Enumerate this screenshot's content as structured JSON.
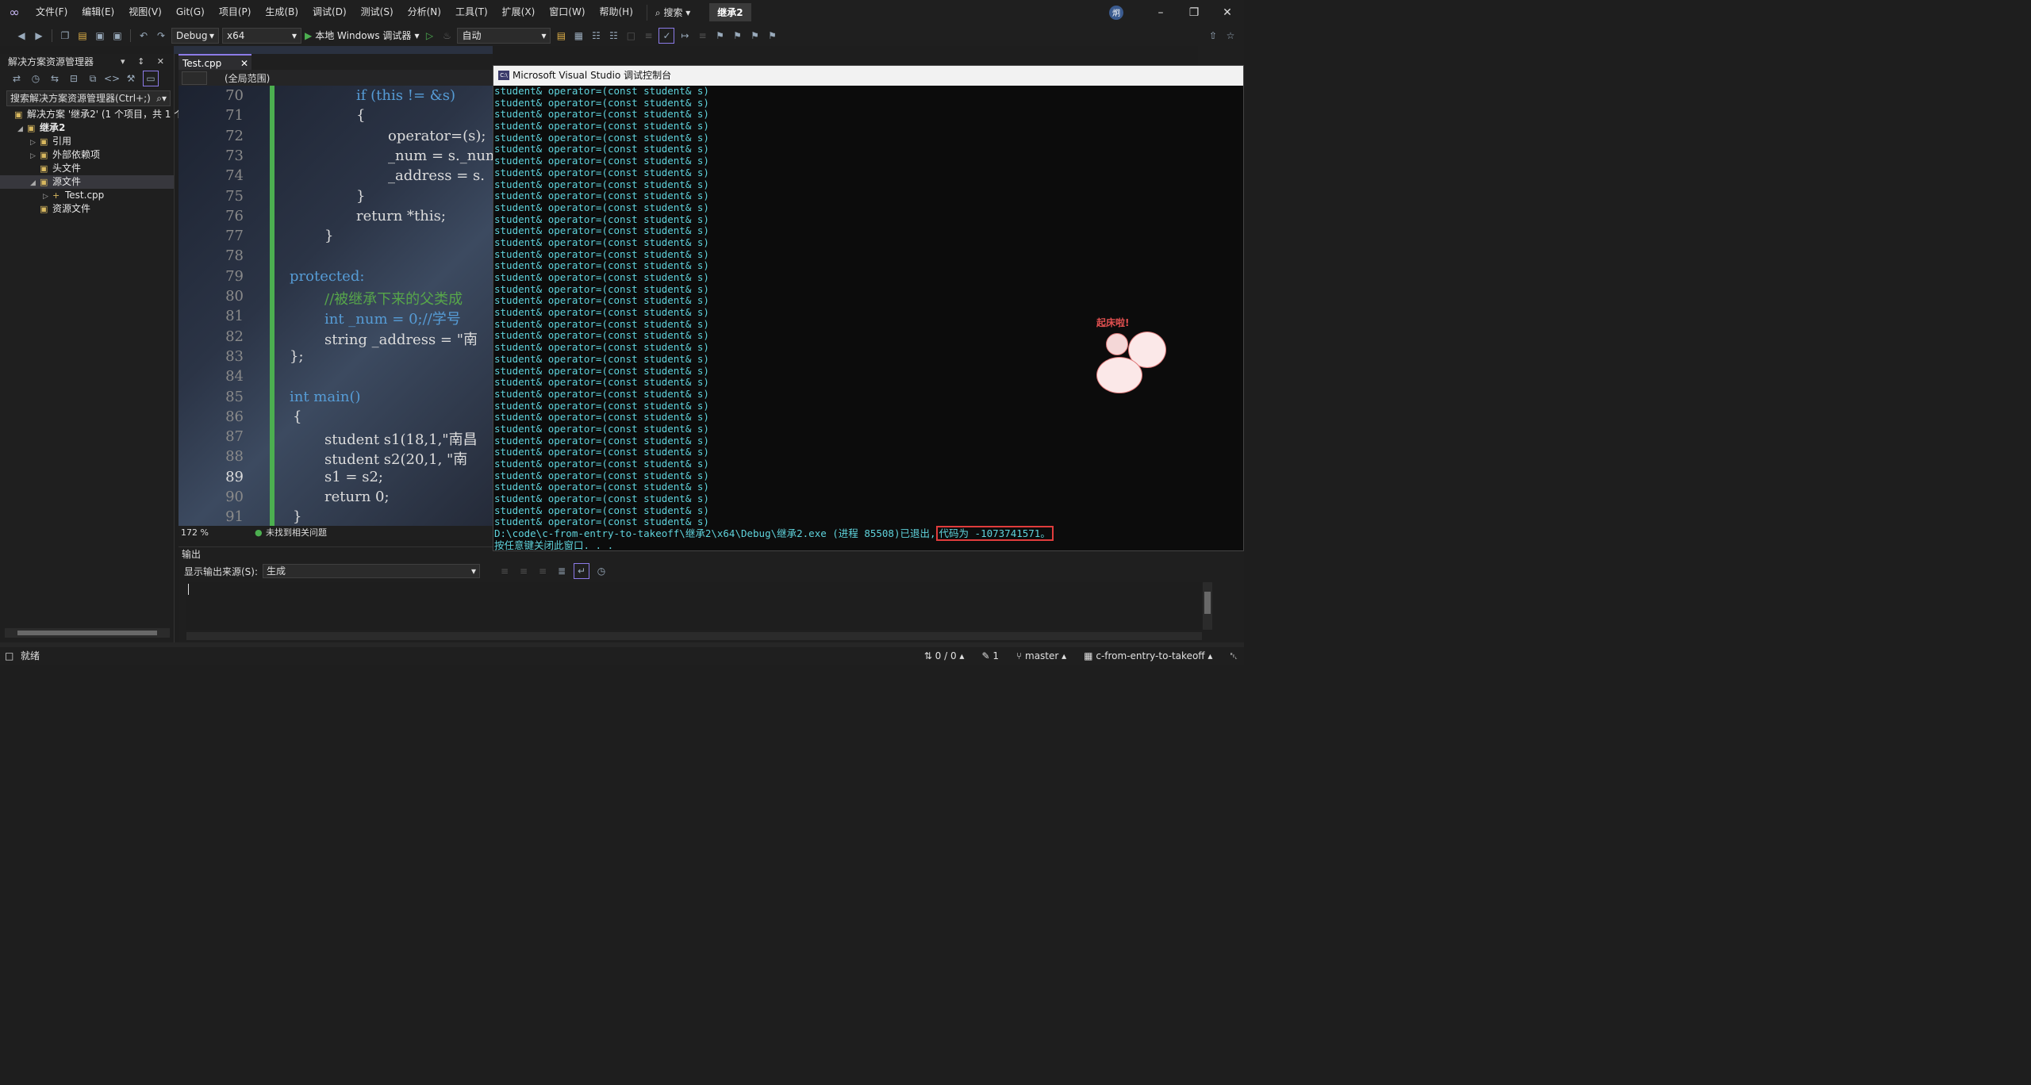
{
  "menubar": {
    "items": [
      "文件(F)",
      "编辑(E)",
      "视图(V)",
      "Git(G)",
      "项目(P)",
      "生成(B)",
      "调试(D)",
      "测试(S)",
      "分析(N)",
      "工具(T)",
      "扩展(X)",
      "窗口(W)",
      "帮助(H)"
    ],
    "search_label": "搜索",
    "solution_name": "继承2",
    "avatar_initial": "炯"
  },
  "toolbar": {
    "config": "Debug",
    "platform": "x64",
    "run_label": "本地 Windows 调试器",
    "auto_label": "自动"
  },
  "solution_explorer": {
    "title": "解决方案资源管理器",
    "search_placeholder": "搜索解决方案资源管理器(Ctrl+;)",
    "tree": [
      {
        "label": "解决方案 '继承2' (1 个项目，共 1 个)",
        "level": 0,
        "icon": "solution-icon"
      },
      {
        "label": "继承2",
        "level": 1,
        "icon": "project-icon"
      },
      {
        "label": "引用",
        "level": 2,
        "icon": "references-icon"
      },
      {
        "label": "外部依赖项",
        "level": 2,
        "icon": "external-deps-icon"
      },
      {
        "label": "头文件",
        "level": 2,
        "icon": "folder-icon"
      },
      {
        "label": "源文件",
        "level": 2,
        "icon": "folder-icon"
      },
      {
        "label": "Test.cpp",
        "level": 3,
        "icon": "cpp-file-icon"
      },
      {
        "label": "资源文件",
        "level": 2,
        "icon": "folder-icon"
      }
    ]
  },
  "editor": {
    "tab": "Test.cpp",
    "scope": "(全局范围)",
    "zoom": "172 %",
    "issues": "未找到相关问题",
    "line_numbers": [
      "70",
      "71",
      "72",
      "73",
      "74",
      "75",
      "76",
      "77",
      "78",
      "79",
      "80",
      "81",
      "82",
      "83",
      "84",
      "85",
      "86",
      "87",
      "88",
      "89",
      "90",
      "91"
    ],
    "lines": [
      "if (this != &s)",
      "{",
      "operator=(s);",
      "_num = s._num",
      "_address = s.",
      "}",
      "return *this;",
      "}",
      "",
      "protected:",
      "//被继承下来的父类成",
      "int _num = 0;//学号",
      "string _address = \"南",
      "};",
      "",
      "int main()",
      "{",
      "student s1(18,1,\"南昌",
      "student s2(20,1, \"南",
      "s1 = s2;",
      "return 0;",
      "}"
    ]
  },
  "output": {
    "title": "输出",
    "source_label": "显示输出来源(S):",
    "source_value": "生成"
  },
  "console": {
    "title": "Microsoft Visual Studio 调试控制台",
    "repeat_line": "student& operator=(const student& s)",
    "repeat_count": 38,
    "exit_prefix": "D:\\code\\c-from-entry-to-takeoff\\继承2\\x64\\Debug\\继承2.exe (进程 85508)已退出,",
    "exit_code": "代码为 -1073741571。",
    "press_key": "按任意键关闭此窗口. . .",
    "sticker_text": "起床啦!"
  },
  "statusbar": {
    "ready": "就绪",
    "sync": "0 / 0",
    "edits": "1",
    "branch": "master",
    "repo": "c-from-entry-to-takeoff"
  }
}
